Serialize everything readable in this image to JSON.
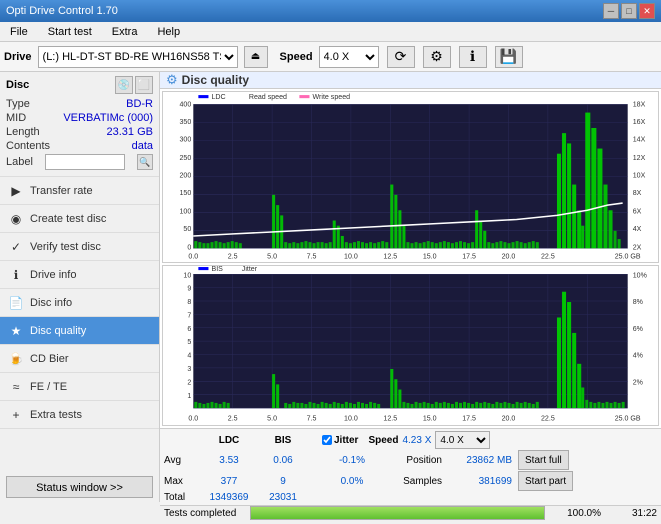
{
  "titlebar": {
    "title": "Opti Drive Control 1.70",
    "min_label": "─",
    "max_label": "□",
    "close_label": "✕"
  },
  "menubar": {
    "items": [
      "File",
      "Start test",
      "Extra",
      "Help"
    ]
  },
  "drivebar": {
    "drive_label": "Drive",
    "drive_value": "(L:)  HL-DT-ST BD-RE  WH16NS58 TST4",
    "speed_label": "Speed",
    "speed_value": "4.0 X"
  },
  "disc": {
    "header": "Disc",
    "type_label": "Type",
    "type_value": "BD-R",
    "mid_label": "MID",
    "mid_value": "VERBATIMc (000)",
    "length_label": "Length",
    "length_value": "23.31 GB",
    "contents_label": "Contents",
    "contents_value": "data",
    "label_label": "Label",
    "label_value": ""
  },
  "nav": {
    "items": [
      {
        "id": "transfer-rate",
        "label": "Transfer rate",
        "icon": "▶"
      },
      {
        "id": "create-test-disc",
        "label": "Create test disc",
        "icon": "◉"
      },
      {
        "id": "verify-test-disc",
        "label": "Verify test disc",
        "icon": "✓"
      },
      {
        "id": "drive-info",
        "label": "Drive info",
        "icon": "ℹ"
      },
      {
        "id": "disc-info",
        "label": "Disc info",
        "icon": "📄"
      },
      {
        "id": "disc-quality",
        "label": "Disc quality",
        "icon": "★",
        "active": true
      },
      {
        "id": "cd-bier",
        "label": "CD Bier",
        "icon": "🍺"
      },
      {
        "id": "fe-te",
        "label": "FE / TE",
        "icon": "≈"
      },
      {
        "id": "extra-tests",
        "label": "Extra tests",
        "icon": "+"
      }
    ],
    "status_btn": "Status window >>"
  },
  "quality": {
    "title": "Disc quality",
    "icon": "⚙",
    "legend1": {
      "ldc_label": "LDC",
      "read_label": "Read speed",
      "write_label": "Write speed"
    },
    "legend2": {
      "bis_label": "BIS",
      "jitter_label": "Jitter"
    },
    "chart1": {
      "y_max": 400,
      "y_labels": [
        "400",
        "350",
        "300",
        "250",
        "200",
        "150",
        "100",
        "50",
        "0"
      ],
      "y_right": [
        "18X",
        "16X",
        "14X",
        "12X",
        "10X",
        "8X",
        "6X",
        "4X",
        "2X"
      ],
      "x_labels": [
        "0.0",
        "2.5",
        "5.0",
        "7.5",
        "10.0",
        "12.5",
        "15.0",
        "17.5",
        "20.0",
        "22.5",
        "25.0 GB"
      ]
    },
    "chart2": {
      "y_max": 10,
      "y_labels": [
        "10",
        "9",
        "8",
        "7",
        "6",
        "5",
        "4",
        "3",
        "2",
        "1"
      ],
      "y_right": [
        "10%",
        "8%",
        "6%",
        "4%",
        "2%"
      ],
      "x_labels": [
        "0.0",
        "2.5",
        "5.0",
        "7.5",
        "10.0",
        "12.5",
        "15.0",
        "17.5",
        "20.0",
        "22.5",
        "25.0 GB"
      ]
    }
  },
  "stats": {
    "col_headers": [
      "",
      "LDC",
      "BIS",
      "",
      "Jitter",
      "Speed",
      ""
    ],
    "avg_label": "Avg",
    "avg_ldc": "3.53",
    "avg_bis": "0.06",
    "avg_jitter": "-0.1%",
    "max_label": "Max",
    "max_ldc": "377",
    "max_bis": "9",
    "max_jitter": "0.0%",
    "total_label": "Total",
    "total_ldc": "1349369",
    "total_bis": "23031",
    "jitter_checked": true,
    "jitter_label": "Jitter",
    "speed_label": "Speed",
    "speed_value": "4.23 X",
    "speed_select": "4.0 X",
    "position_label": "Position",
    "position_value": "23862 MB",
    "samples_label": "Samples",
    "samples_value": "381699",
    "start_full_label": "Start full",
    "start_part_label": "Start part"
  },
  "progress": {
    "status_text": "Tests completed",
    "percent": "100.0%",
    "time": "31:22"
  }
}
